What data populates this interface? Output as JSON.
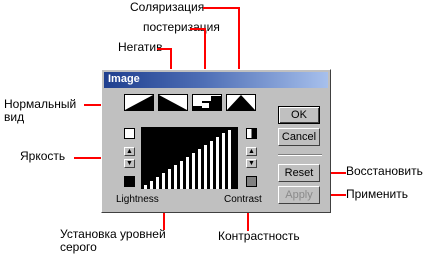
{
  "dialog": {
    "title": "Image",
    "buttons": {
      "ok": "OK",
      "cancel": "Cancel",
      "reset": "Reset",
      "apply": "Apply"
    },
    "labels": {
      "lightness": "Lightness",
      "contrast": "Contrast"
    },
    "tools": [
      {
        "name": "normal-view-icon"
      },
      {
        "name": "negative-icon"
      },
      {
        "name": "posterize-icon"
      },
      {
        "name": "solarize-icon"
      }
    ]
  },
  "callouts": {
    "solarize": "Соляризация",
    "posterize": "постеризация",
    "negative": "Негатив",
    "normal_view": "Нормальный вид",
    "brightness": "Яркость",
    "gray_levels": "Установка уровней серого",
    "contrast": "Контрастность",
    "restore": "Восстановить",
    "apply": "Применить"
  },
  "colors": {
    "callout_line": "#ff0000",
    "title_start": "#1f3f8f",
    "title_end": "#a7c0ec"
  }
}
